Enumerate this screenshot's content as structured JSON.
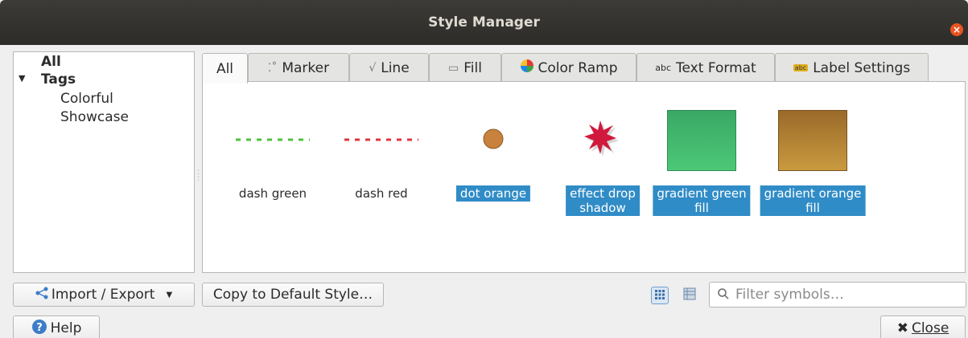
{
  "window": {
    "title": "Style Manager",
    "close_glyph": "×"
  },
  "tree": {
    "items": [
      {
        "label": "All"
      },
      {
        "label": "Tags",
        "expanded": true
      },
      {
        "label": "Colorful"
      },
      {
        "label": "Showcase"
      }
    ],
    "arrow": "▼"
  },
  "tabs": [
    {
      "label": "All",
      "icon": "",
      "active": true
    },
    {
      "label": "Marker",
      "icon": "marker-icon"
    },
    {
      "label": "Line",
      "icon": "line-icon"
    },
    {
      "label": "Fill",
      "icon": "fill-icon"
    },
    {
      "label": "Color Ramp",
      "icon": "color-ramp-icon"
    },
    {
      "label": "Text Format",
      "icon": "text-format-icon",
      "icon_text": "abc"
    },
    {
      "label": "Label Settings",
      "icon": "label-settings-icon",
      "icon_text": "abc"
    }
  ],
  "symbols": [
    {
      "name": "dash green",
      "selected": false,
      "color": "#4fbf3f"
    },
    {
      "name": "dash red",
      "selected": false,
      "color": "#e0343f"
    },
    {
      "name": "dot orange",
      "selected": true,
      "color": "#c8823e"
    },
    {
      "name": "effect drop\nshadow",
      "selected": true,
      "color": "#d0193c"
    },
    {
      "name": "gradient green\nfill",
      "selected": true,
      "color": "#3fae6a"
    },
    {
      "name": "gradient orange\nfill",
      "selected": true,
      "color": "#b07a2e"
    }
  ],
  "buttons": {
    "import_export": "Import / Export",
    "copy_default": "Copy to Default Style…",
    "help": "Help",
    "close": "Close"
  },
  "filter": {
    "placeholder": "Filter symbols…"
  },
  "colors": {
    "selection": "#308cc6",
    "accent": "#e95420"
  }
}
